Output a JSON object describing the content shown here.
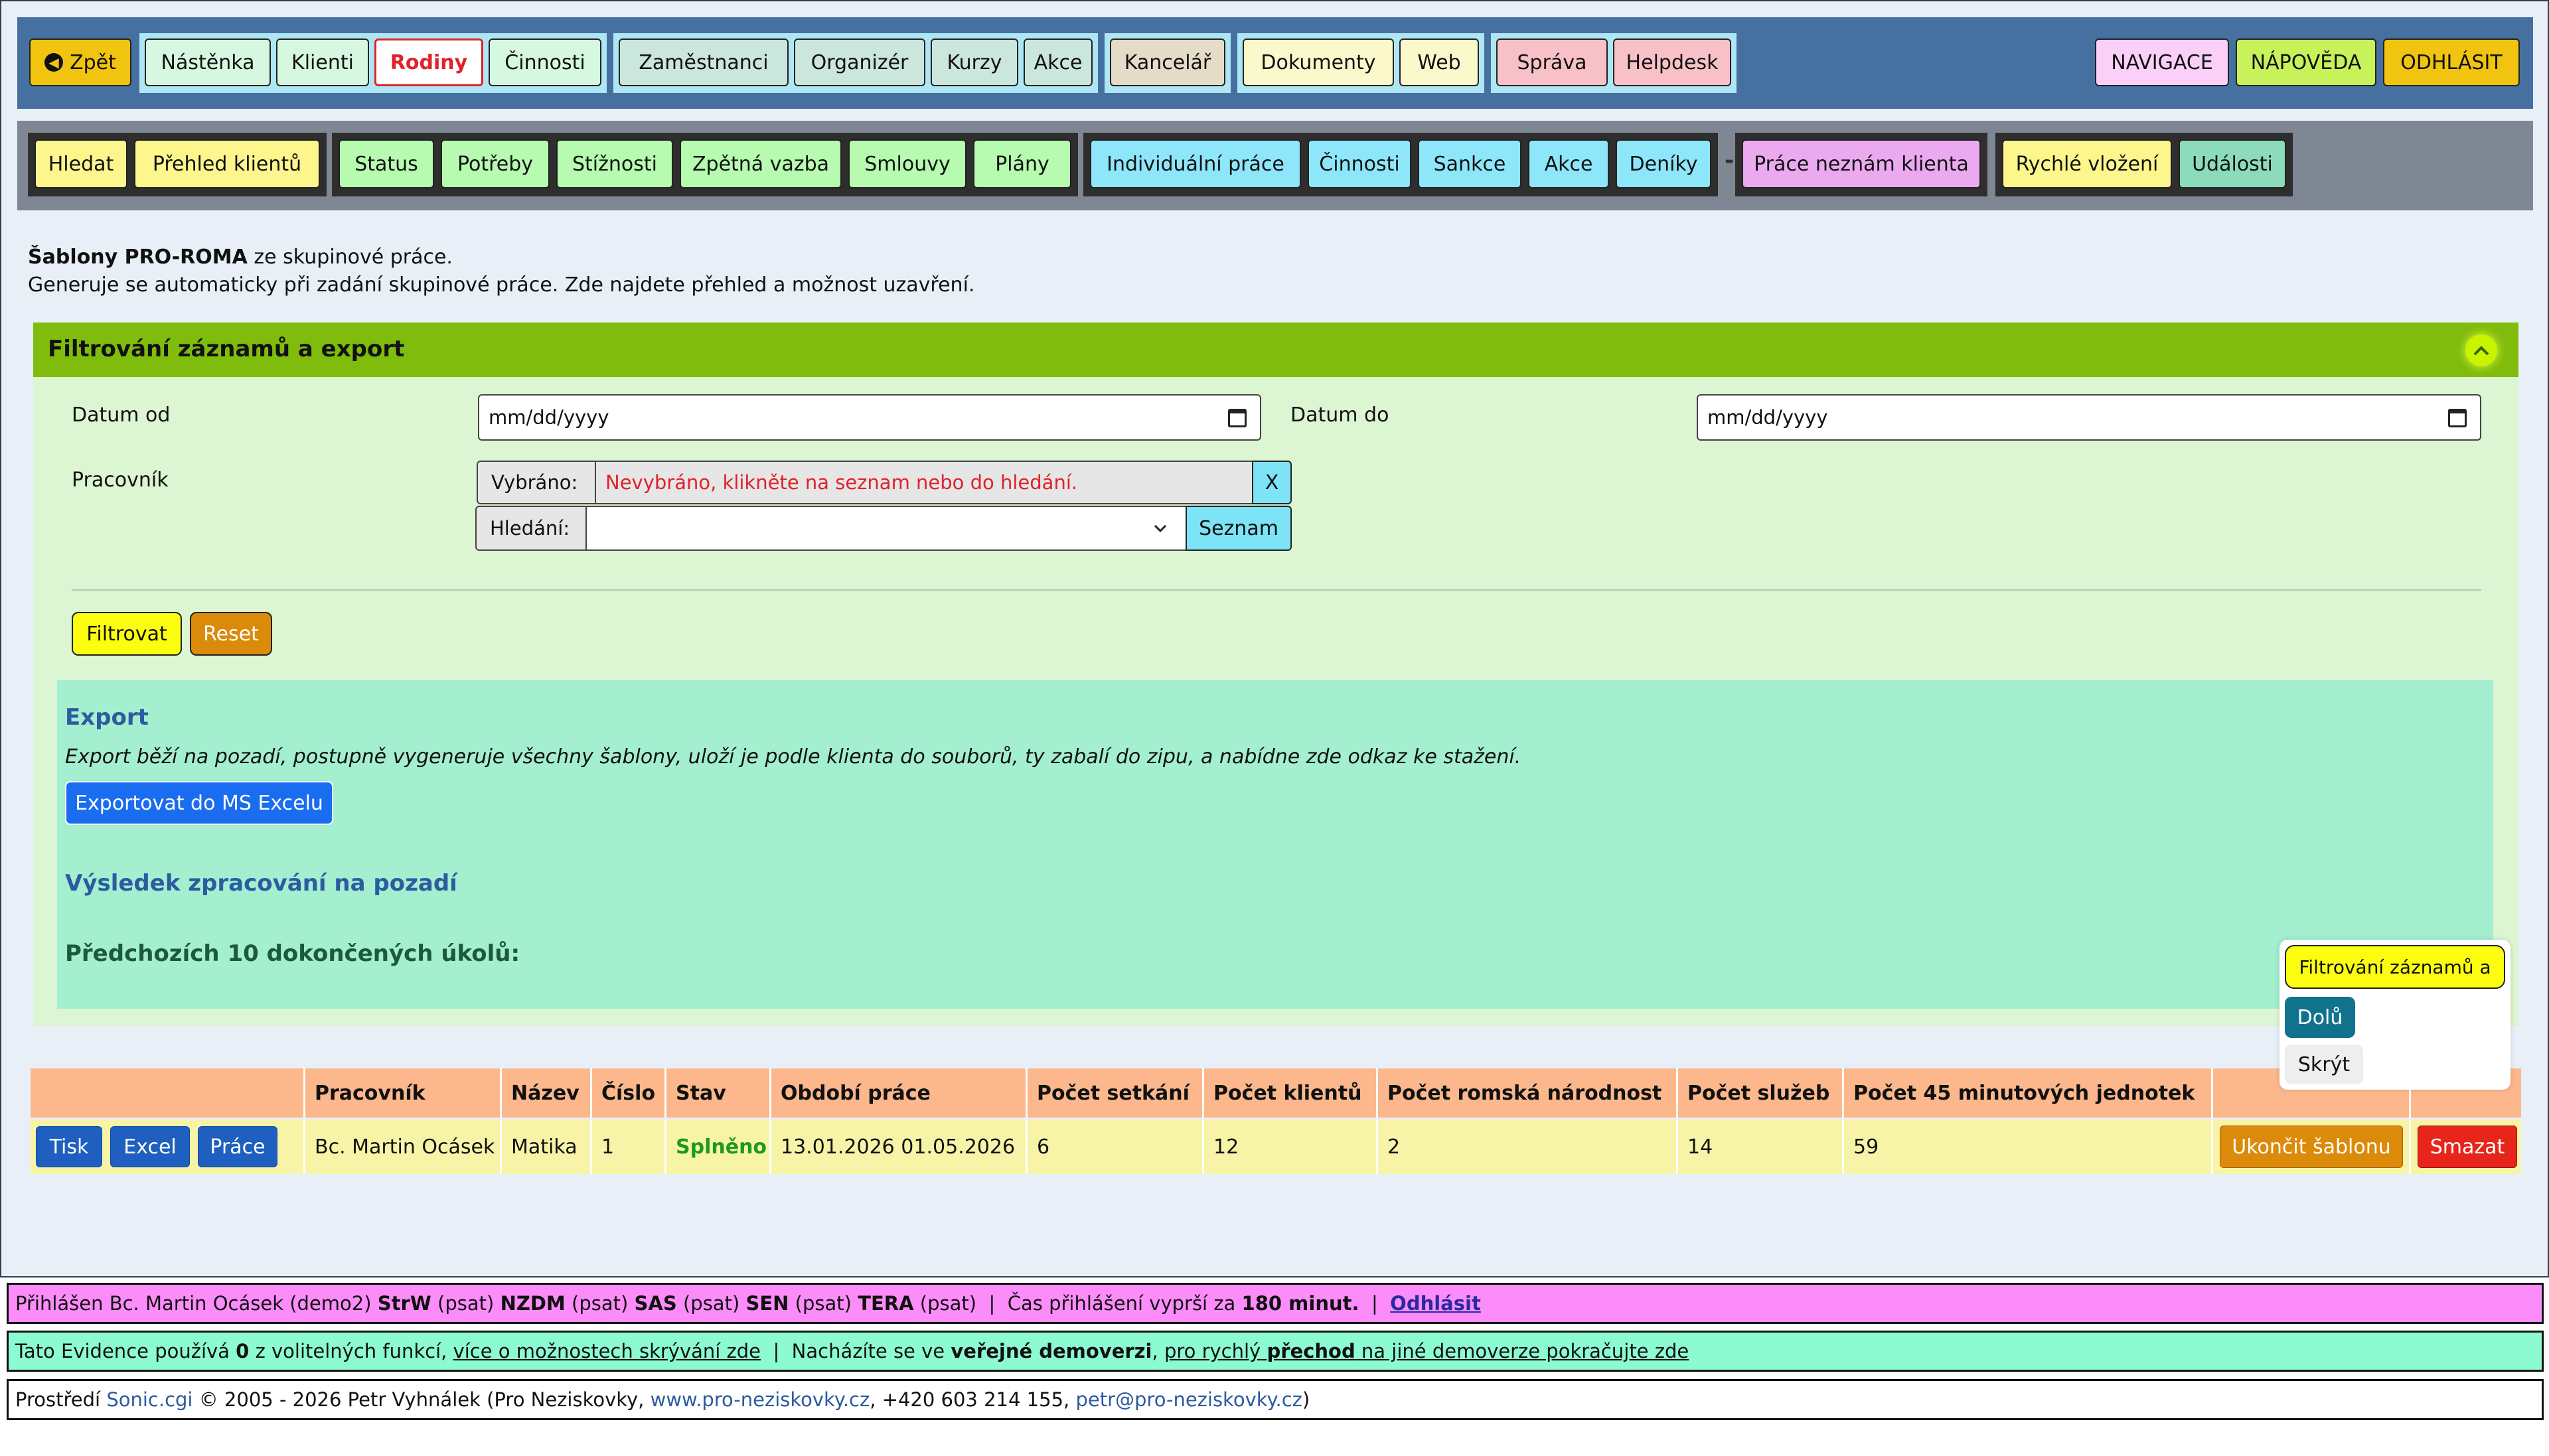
{
  "topbar": {
    "back_label": "Zpět",
    "group1": [
      "Nástěnka",
      "Klienti",
      "Rodiny",
      "Činnosti"
    ],
    "group2": [
      "Zaměstnanci",
      "Organizér",
      "Kurzy",
      "Akce"
    ],
    "group3": [
      "Kancelář"
    ],
    "group4": [
      "Dokumenty",
      "Web"
    ],
    "group5": [
      "Správa",
      "Helpdesk"
    ],
    "right": [
      "NAVIGACE",
      "NÁPOVĚDA",
      "ODHLÁSIT"
    ],
    "active_item": "Rodiny"
  },
  "subbar": {
    "group1": [
      "Hledat",
      "Přehled klientů"
    ],
    "group2": [
      "Status",
      "Potřeby",
      "Stížnosti",
      "Zpětná vazba",
      "Smlouvy",
      "Plány"
    ],
    "group3": [
      "Individuální práce",
      "Činnosti",
      "Sankce",
      "Akce",
      "Deníky"
    ],
    "separator": "-",
    "group4": [
      "Práce neznám klienta"
    ],
    "group5": [
      "Rychlé vložení",
      "Události"
    ]
  },
  "intro": {
    "title_bold": "Šablony PRO-ROMA",
    "title_rest": " ze skupinové práce.",
    "line2": "Generuje se automaticky při zadání skupinové práce. Zde najdete přehled a možnost uzavření."
  },
  "filter": {
    "header": "Filtrování záznamů a export",
    "date_from_label": "Datum od",
    "date_from_placeholder": "mm/dd/yyyy",
    "date_to_label": "Datum do",
    "date_to_placeholder": "mm/dd/yyyy",
    "worker_label": "Pracovník",
    "selected_label": "Vybráno:",
    "selected_value": "Nevybráno, klikněte na seznam nebo do hledání.",
    "clear_label": "X",
    "search_label": "Hledání:",
    "list_label": "Seznam",
    "filter_button": "Filtrovat",
    "reset_button": "Reset"
  },
  "export": {
    "title": "Export",
    "description": "Export běží na pozadí, postupně vygeneruje všechny šablony, uloží je podle klienta do souborů, ty zabalí do zipu, a nabídne zde odkaz ke stažení.",
    "button": "Exportovat do MS Excelu",
    "result_title": "Výsledek zpracování na pozadí",
    "previous_title": "Předchozích 10 dokončených úkolů:"
  },
  "table": {
    "headers": [
      "",
      "Pracovník",
      "Název",
      "Číslo",
      "Stav",
      "Období práce",
      "Počet setkání",
      "Počet klientů",
      "Počet romská národnost",
      "Počet služeb",
      "Počet 45 minutových jednotek",
      "",
      ""
    ],
    "row": {
      "actions": [
        "Tisk",
        "Excel",
        "Práce"
      ],
      "worker": "Bc. Martin Ocásek",
      "name": "Matika",
      "number": "1",
      "status": "Splněno",
      "period": "13.01.2026 01.05.2026",
      "meetings": "6",
      "clients": "12",
      "roma": "2",
      "services": "14",
      "units": "59",
      "end_button": "Ukončit šablonu",
      "delete_button": "Smazat"
    }
  },
  "float_menu": {
    "item1": "Filtrování záznamů a",
    "item2": "Dolů",
    "item3": "Skrýt"
  },
  "footer": {
    "login_prefix": "Přihlášen Bc. Martin Ocásek (demo2)",
    "roles": [
      {
        "code": "StrW",
        "mode": "(psat)"
      },
      {
        "code": "NZDM",
        "mode": "(psat)"
      },
      {
        "code": "SAS",
        "mode": "(psat)"
      },
      {
        "code": "SEN",
        "mode": "(psat)"
      },
      {
        "code": "TERA",
        "mode": "(psat)"
      }
    ],
    "sep": "|",
    "expire_text": "Čas přihlášení vyprší za",
    "expire_value": "180 minut.",
    "logout": "Odhlásit",
    "line2_a": "Tato Evidence používá",
    "line2_count": "0",
    "line2_b": "z volitelných funkcí,",
    "line2_link": "více o možnostech skrývání zde",
    "line2_c": "Nacházíte se ve",
    "line2_d": "veřejné demoverzi",
    "line2_e": ",",
    "line2_link2_a": "pro rychlý",
    "line2_link2_b": "přechod",
    "line2_link2_c": "na jiné demoverze pokračujte zde",
    "line3_a": "Prostředí",
    "line3_sonic": "Sonic.cgi",
    "line3_b": "© 2005 - 2026 Petr Vyhnálek (Pro Neziskovky,",
    "line3_web": "www.pro-neziskovky.cz",
    "line3_c": ", +420 603 214 155,",
    "line3_mail": "petr@pro-neziskovky.cz",
    "line3_d": ")"
  },
  "colors": {
    "topbar": "#4670a0",
    "subbar": "#7f8794",
    "filter_header": "#7fbc0b",
    "filter_body": "#dcf5d2",
    "export_box": "#a3efd0",
    "table_header": "#fcb88c",
    "table_row": "#f8f4a7",
    "footer_login": "#fd8cfb",
    "footer_info": "#8cfbd2"
  }
}
